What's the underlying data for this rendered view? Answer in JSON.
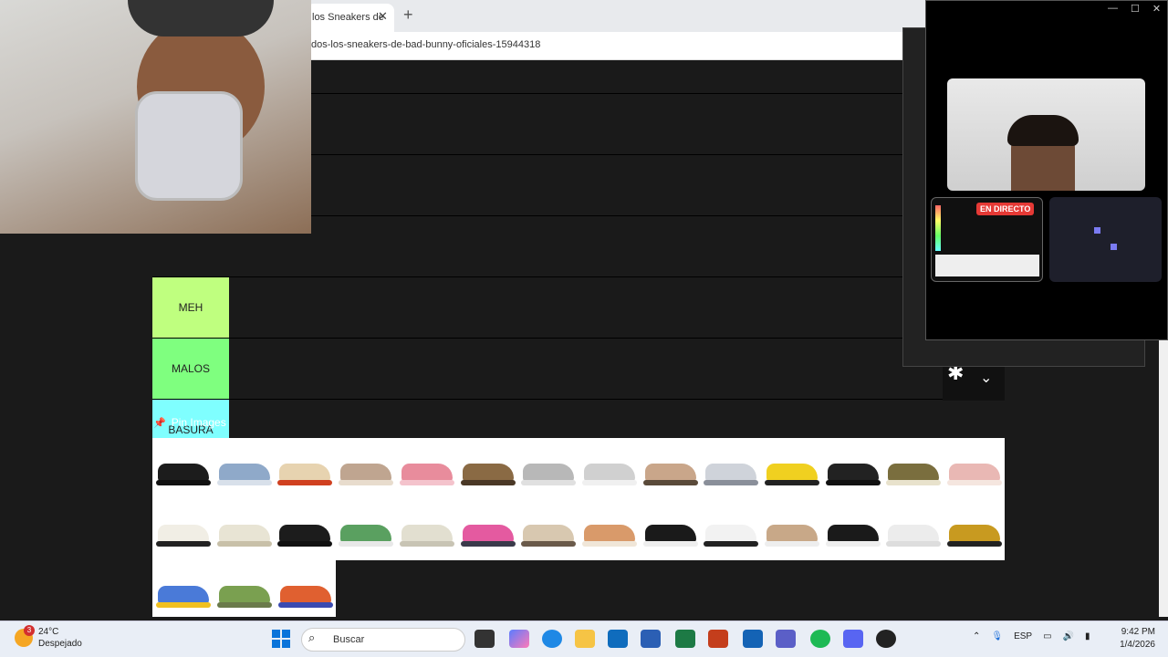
{
  "browser": {
    "tab_title": "los Sneakers de",
    "tab_close": "✕",
    "new_tab": "+",
    "url": "dos-los-sneakers-de-bad-bunny-oficiales-15944318"
  },
  "tiers": [
    {
      "label": "",
      "color": "#1a1a1a"
    },
    {
      "label": "",
      "color": "#1a1a1a"
    },
    {
      "label": "",
      "color": "#1a1a1a"
    },
    {
      "label": "MEH",
      "color": "#bfff7f"
    },
    {
      "label": "MALOS",
      "color": "#7fff7f"
    },
    {
      "label": "BASURA",
      "color": "#7fffff"
    }
  ],
  "settings": {
    "gear": "✱",
    "chevron": "⌄"
  },
  "pin": {
    "icon": "📌",
    "title": "Pin Images"
  },
  "call": {
    "live_label": "EN DIRECTO",
    "controls": [
      "—",
      "☐",
      "✕"
    ]
  },
  "taskbar": {
    "temperature": "24°C",
    "weather": "Despejado",
    "weather_badge": "3",
    "search_placeholder": "Buscar",
    "language": "ESP",
    "time": "9:42 PM",
    "date": "1/4/2026"
  },
  "shoe_colors": [
    [
      "#1c1c1c",
      "#111"
    ],
    [
      "#8fa9c9",
      "#d8e0ea"
    ],
    [
      "#e7d3b0",
      "#d04020"
    ],
    [
      "#bfa590",
      "#e8dccd"
    ],
    [
      "#e88c9c",
      "#f4c3cc"
    ],
    [
      "#8a6a44",
      "#4a3826"
    ],
    [
      "#b8b8b8",
      "#e0e0e0"
    ],
    [
      "#d0d0d0",
      "#f0f0f0"
    ],
    [
      "#c9a68a",
      "#5a4a3a"
    ],
    [
      "#cfd3da",
      "#8a8f9a"
    ],
    [
      "#f0d020",
      "#222"
    ],
    [
      "#222",
      "#111"
    ],
    [
      "#7a6e3e",
      "#e8e2cc"
    ],
    [
      "#e9b8b4",
      "#f5e6df"
    ],
    [
      "#f1eee5",
      "#222"
    ],
    [
      "#e8e4d4",
      "#c8c0a8"
    ],
    [
      "#1c1c1c",
      "#111"
    ],
    [
      "#5aa060",
      "#e8e8e8"
    ],
    [
      "#e2dfd0",
      "#c8c4b4"
    ],
    [
      "#e45aa0",
      "#3a3a4a"
    ],
    [
      "#d8c8b0",
      "#6a5a4a"
    ],
    [
      "#d99a6a",
      "#f0e6d8"
    ],
    [
      "#1a1a1a",
      "#eee"
    ],
    [
      "#f2f2f2",
      "#222"
    ],
    [
      "#c8a888",
      "#eee"
    ],
    [
      "#1a1a1a",
      "#eee"
    ],
    [
      "#ececec",
      "#ddd"
    ],
    [
      "#c89a20",
      "#222"
    ],
    [
      "#4a7ad8",
      "#f0c020"
    ],
    [
      "#7aa050",
      "#6a7a4a"
    ],
    [
      "#e06030",
      "#3a4ab0"
    ]
  ]
}
